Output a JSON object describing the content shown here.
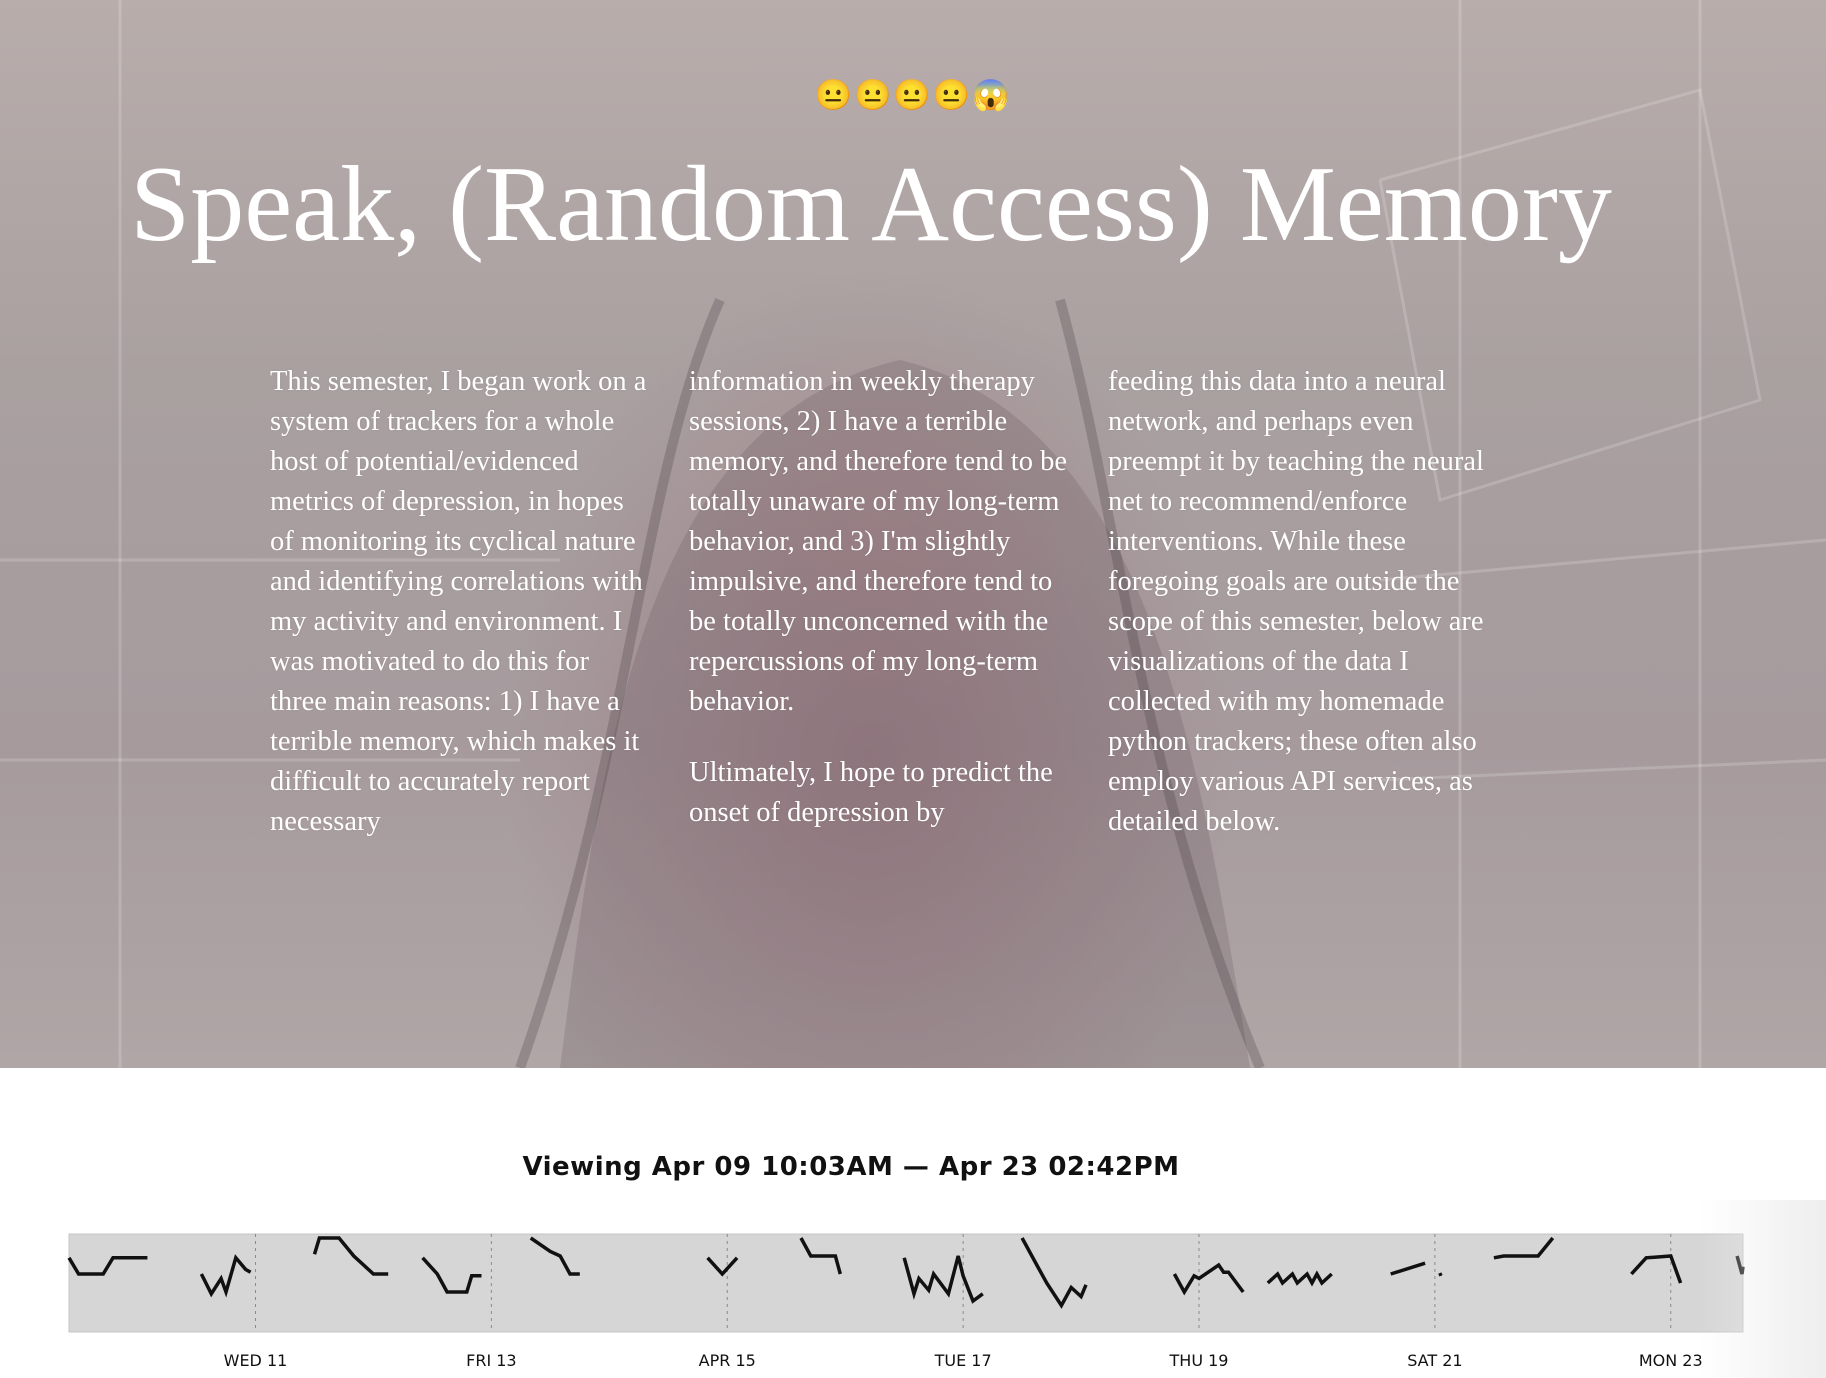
{
  "hero": {
    "emoji": "😐😐😐😐😱",
    "title": "Speak, (Random Access) Memory",
    "columns": [
      [
        "This semester, I began work on a system of trackers for a whole host of potential/evidenced metrics of depression, in hopes of monitoring its cyclical nature and identifying correlations with my activity and environment. I was motivated to do this for three main reasons: 1) I have a terrible memory, which makes it difficult to accurately report necessary"
      ],
      [
        "information in weekly therapy sessions, 2) I have a terrible memory, and therefore tend to be totally unaware of my long-term behavior, and 3) I'm slightly impulsive, and therefore tend to be totally unconcerned with the repercussions of my long-term behavior.",
        "Ultimately, I hope to predict the onset of depression by"
      ],
      [
        "feeding this data into a neural network, and perhaps even preempt it by teaching the neural net to recommend/enforce interventions. While these foregoing goals are outside the scope of this semester, below are visualizations of the data I collected with my homemade python trackers; these often also employ various API services, as detailed below."
      ]
    ]
  },
  "timeline": {
    "viewing_label": "Viewing Apr 09 10:03AM — Apr 23 02:42PM",
    "colors": {
      "band": "#d6d6d6",
      "line": "#111111",
      "divider": "#8a8a8a"
    },
    "chart_data": {
      "type": "line",
      "title": "",
      "x_start": "2017-04-09 10:03",
      "x_end": "2017-04-23 14:42",
      "tick_labels": [
        "WED 11",
        "FRI 13",
        "APR 15",
        "TUE 17",
        "THU 19",
        "SAT 21",
        "MON 23"
      ],
      "tick_dates": [
        "2017-04-11 00:00",
        "2017-04-13 00:00",
        "2017-04-15 00:00",
        "2017-04-17 00:00",
        "2017-04-19 00:00",
        "2017-04-21 00:00",
        "2017-04-23 00:00"
      ],
      "ylim": [
        0,
        1
      ],
      "segments": [
        {
          "x": [
            "2017-04-09 10:03",
            "2017-04-09 12:00",
            "2017-04-09 17:00",
            "2017-04-09 19:00",
            "2017-04-10 02:00"
          ],
          "y": [
            0.78,
            0.6,
            0.6,
            0.78,
            0.78
          ]
        },
        {
          "x": [
            "2017-04-10 13:00",
            "2017-04-10 15:00",
            "2017-04-10 17:00",
            "2017-04-10 18:00",
            "2017-04-10 20:00",
            "2017-04-10 22:00",
            "2017-04-10 23:00"
          ],
          "y": [
            0.6,
            0.38,
            0.55,
            0.4,
            0.78,
            0.65,
            0.62
          ]
        },
        {
          "x": [
            "2017-04-11 12:00",
            "2017-04-11 13:00",
            "2017-04-11 17:00",
            "2017-04-11 20:00",
            "2017-04-12 00:00",
            "2017-04-12 03:00"
          ],
          "y": [
            0.82,
            1.0,
            1.0,
            0.8,
            0.6,
            0.6
          ]
        },
        {
          "x": [
            "2017-04-12 10:00",
            "2017-04-12 13:00",
            "2017-04-12 15:00",
            "2017-04-12 19:00",
            "2017-04-12 20:00",
            "2017-04-12 22:00"
          ],
          "y": [
            0.78,
            0.6,
            0.4,
            0.4,
            0.58,
            0.58
          ]
        },
        {
          "x": [
            "2017-04-13 08:00",
            "2017-04-13 12:00",
            "2017-04-13 14:00",
            "2017-04-13 16:00",
            "2017-04-13 18:00"
          ],
          "y": [
            1.0,
            0.85,
            0.8,
            0.6,
            0.6
          ]
        },
        {
          "x": [
            "2017-04-14 20:00",
            "2017-04-14 23:00",
            "2017-04-15 02:00"
          ],
          "y": [
            0.78,
            0.6,
            0.78
          ]
        },
        {
          "x": [
            "2017-04-15 15:00",
            "2017-04-15 17:00",
            "2017-04-15 22:00",
            "2017-04-15 23:00"
          ],
          "y": [
            1.0,
            0.8,
            0.8,
            0.6
          ]
        },
        {
          "x": [
            "2017-04-16 12:00",
            "2017-04-16 14:00",
            "2017-04-16 15:00",
            "2017-04-16 17:00",
            "2017-04-16 18:00",
            "2017-04-16 21:00",
            "2017-04-16 23:00",
            "2017-04-17 00:00",
            "2017-04-17 02:00",
            "2017-04-17 04:00"
          ],
          "y": [
            0.78,
            0.38,
            0.55,
            0.42,
            0.6,
            0.38,
            0.8,
            0.58,
            0.3,
            0.38
          ]
        },
        {
          "x": [
            "2017-04-17 12:00",
            "2017-04-17 15:00",
            "2017-04-17 17:00",
            "2017-04-17 20:00",
            "2017-04-17 22:00",
            "2017-04-18 00:00",
            "2017-04-18 01:00"
          ],
          "y": [
            1.0,
            0.7,
            0.5,
            0.25,
            0.45,
            0.35,
            0.48
          ]
        },
        {
          "x": [
            "2017-04-18 19:00",
            "2017-04-18 21:00",
            "2017-04-18 23:00",
            "2017-04-19 00:00",
            "2017-04-19 04:00",
            "2017-04-19 05:00",
            "2017-04-19 06:00",
            "2017-04-19 09:00"
          ],
          "y": [
            0.6,
            0.4,
            0.58,
            0.55,
            0.7,
            0.62,
            0.62,
            0.4
          ]
        },
        {
          "x": [
            "2017-04-19 14:00",
            "2017-04-19 16:00",
            "2017-04-19 17:00",
            "2017-04-19 19:00",
            "2017-04-19 20:00",
            "2017-04-19 22:00",
            "2017-04-19 23:00",
            "2017-04-20 00:00",
            "2017-04-20 01:00",
            "2017-04-20 03:00"
          ],
          "y": [
            0.5,
            0.6,
            0.5,
            0.6,
            0.5,
            0.6,
            0.5,
            0.6,
            0.5,
            0.6
          ]
        },
        {
          "x": [
            "2017-04-20 15:00",
            "2017-04-20 22:00"
          ],
          "y": [
            0.6,
            0.72
          ]
        },
        {
          "x": [
            "2017-04-21 01:00",
            "2017-04-21 01:15"
          ],
          "y": [
            0.61,
            0.58
          ]
        },
        {
          "x": [
            "2017-04-21 12:00",
            "2017-04-21 14:00",
            "2017-04-21 21:00",
            "2017-04-22 00:00"
          ],
          "y": [
            0.78,
            0.8,
            0.8,
            1.0
          ]
        },
        {
          "x": [
            "2017-04-22 16:00",
            "2017-04-22 19:00",
            "2017-04-23 00:00",
            "2017-04-23 02:00"
          ],
          "y": [
            0.6,
            0.78,
            0.8,
            0.5
          ]
        },
        {
          "x": [
            "2017-04-23 13:30",
            "2017-04-23 14:30",
            "2017-04-23 14:42"
          ],
          "y": [
            0.8,
            0.6,
            0.68
          ]
        }
      ]
    }
  }
}
